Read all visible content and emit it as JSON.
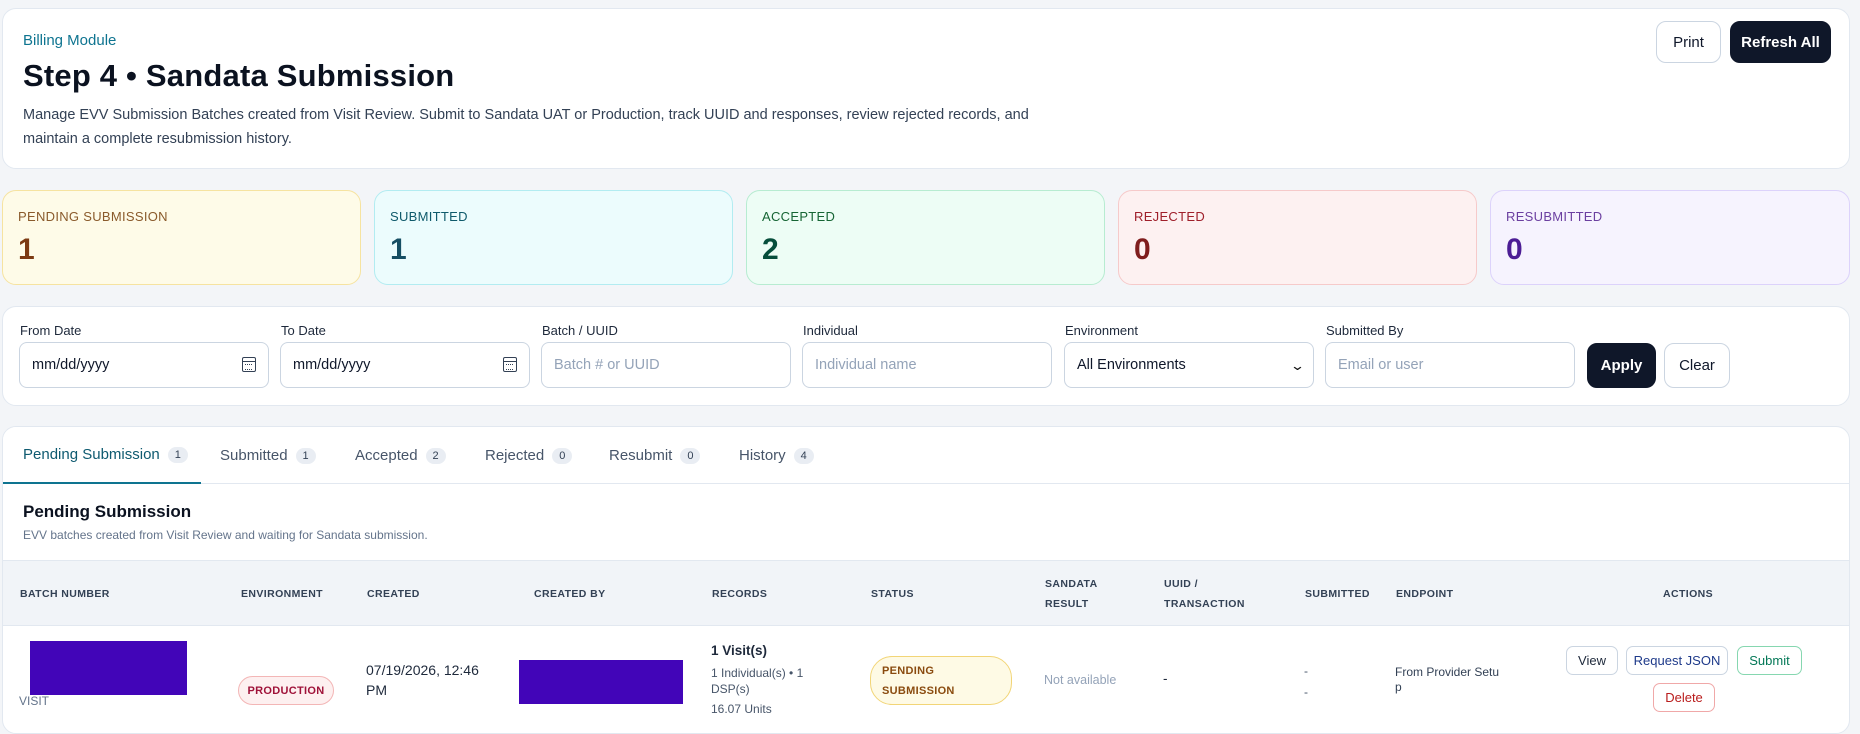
{
  "header": {
    "module_label": "Billing Module",
    "title": "Step 4 • Sandata Submission",
    "description": "Manage EVV Submission Batches created from Visit Review. Submit to Sandata UAT or Production, track UUID and responses, review rejected records, and maintain a complete resubmission history.",
    "print_label": "Print",
    "refresh_label": "Refresh All"
  },
  "stats": {
    "pending": {
      "label": "PENDING SUBMISSION",
      "value": "1"
    },
    "submitted": {
      "label": "SUBMITTED",
      "value": "1"
    },
    "accepted": {
      "label": "ACCEPTED",
      "value": "2"
    },
    "rejected": {
      "label": "REJECTED",
      "value": "0"
    },
    "resubmitted": {
      "label": "RESUBMITTED",
      "value": "0"
    }
  },
  "filters": {
    "from_date": {
      "label": "From Date",
      "value": "mm/dd/yyyy"
    },
    "to_date": {
      "label": "To Date",
      "value": "mm/dd/yyyy"
    },
    "batch": {
      "label": "Batch / UUID",
      "placeholder": "Batch # or UUID"
    },
    "individual": {
      "label": "Individual",
      "placeholder": "Individual name"
    },
    "environment": {
      "label": "Environment",
      "value": "All Environments"
    },
    "submitted_by": {
      "label": "Submitted By",
      "placeholder": "Email or user"
    },
    "apply_label": "Apply",
    "clear_label": "Clear"
  },
  "tabs": [
    {
      "label": "Pending Submission",
      "count": "1"
    },
    {
      "label": "Submitted",
      "count": "1"
    },
    {
      "label": "Accepted",
      "count": "2"
    },
    {
      "label": "Rejected",
      "count": "0"
    },
    {
      "label": "Resubmit",
      "count": "0"
    },
    {
      "label": "History",
      "count": "4"
    }
  ],
  "section": {
    "title": "Pending Submission",
    "subtitle": "EVV batches created from Visit Review and waiting for Sandata submission."
  },
  "table": {
    "headers": {
      "batch_number": "BATCH NUMBER",
      "environment": "ENVIRONMENT",
      "created": "CREATED",
      "created_by": "CREATED BY",
      "records": "RECORDS",
      "status": "STATUS",
      "sandata_result_1": "SANDATA",
      "sandata_result_2": "RESULT",
      "uuid_1": "UUID /",
      "uuid_2": "TRANSACTION",
      "submitted": "SUBMITTED",
      "endpoint": "ENDPOINT",
      "actions": "ACTIONS"
    },
    "rows": [
      {
        "batch_type": "VISIT",
        "environment": "PRODUCTION",
        "created_1": "07/19/2026, 12:46",
        "created_2": "PM",
        "records_title": "1 Visit(s)",
        "records_detail_1": "1 Individual(s) • 1",
        "records_detail_2": "DSP(s)",
        "records_units": "16.07 Units",
        "status_1": "PENDING",
        "status_2": "SUBMISSION",
        "sandata_result": "Not available",
        "uuid": "-",
        "submitted_1": "-",
        "submitted_2": "-",
        "endpoint_1": "From Provider Setu",
        "endpoint_2": "p",
        "actions": {
          "view": "View",
          "request_json": "Request JSON",
          "submit": "Submit",
          "delete": "Delete"
        }
      }
    ]
  }
}
